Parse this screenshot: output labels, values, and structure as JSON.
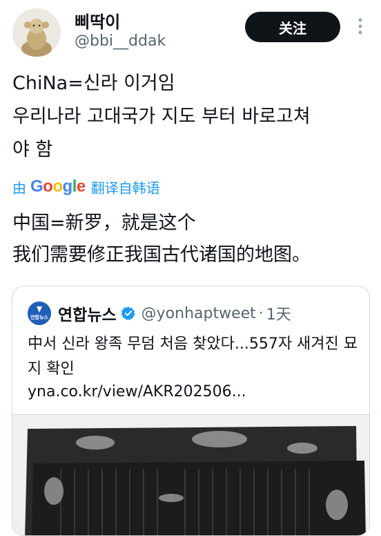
{
  "author": {
    "display_name": "삐딱이",
    "handle": "@bbi__ddak",
    "follow_label": "关注"
  },
  "tweet": {
    "text": "ChiNa=신라 이거임\n우리나라 고대국가 지도 부터 바로고쳐\n야 함"
  },
  "translation": {
    "prefix": "由",
    "provider": "Google",
    "label": "翻译自韩语",
    "text": "中国=新罗，就是这个\n我们需要修正我国古代诸国的地图。"
  },
  "quoted_tweet": {
    "avatar_text": "연합뉴스",
    "display_name": "연합뉴스",
    "handle": "@yonhaptweet",
    "separator": "·",
    "time": "1天",
    "text": "中서 신라 왕족 무덤 처음 찾았다...557자 새겨진 묘지 확인",
    "link": "yna.co.kr/view/AKR202506..."
  },
  "colors": {
    "accent": "#1d9bf0",
    "text_primary": "#0f1419",
    "text_secondary": "#536471",
    "border": "#cfd9de",
    "verified": "#1d9bf0"
  },
  "icons": [
    "avatar-image",
    "more-icon",
    "google-logo",
    "verified-icon",
    "rubbing-image"
  ]
}
